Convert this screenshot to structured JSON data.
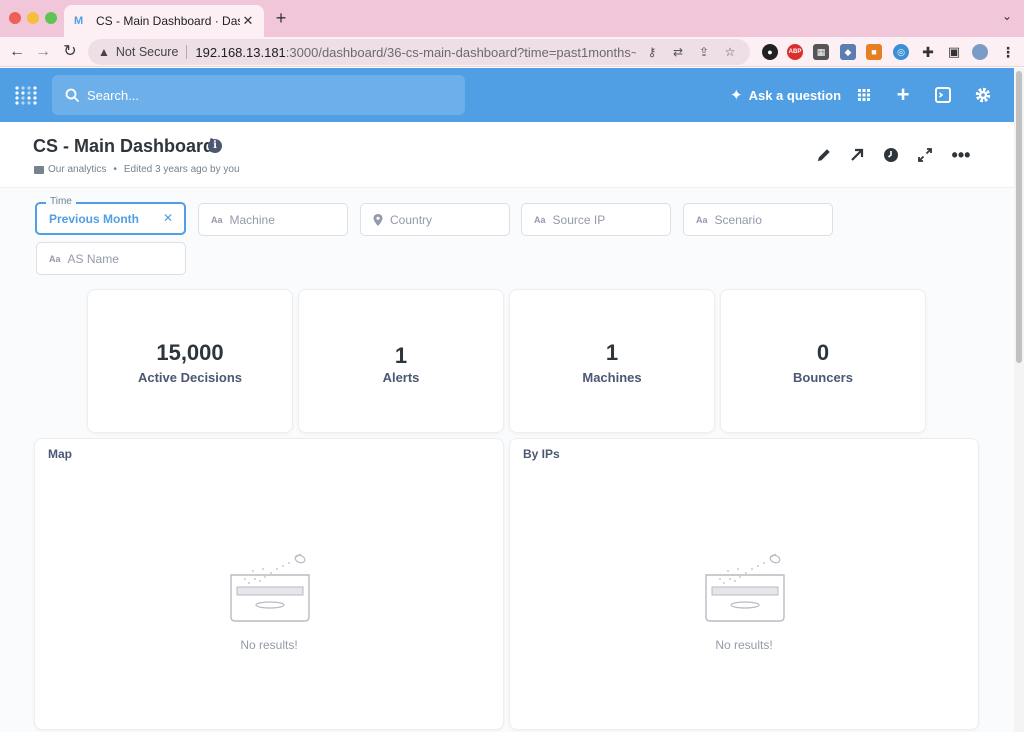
{
  "browser": {
    "tab_title": "CS - Main Dashboard · Dashboard",
    "security_label": "Not Secure",
    "url_host": "192.168.13.181",
    "url_rest": ":3000/dashboard/36-cs-main-dashboard?time=past1months~"
  },
  "header": {
    "search_placeholder": "Search...",
    "ask_label": "Ask a question"
  },
  "dashboard": {
    "title": "CS - Main Dashboard",
    "collection": "Our analytics",
    "edited": "Edited 3 years ago by you"
  },
  "filters": [
    {
      "legend": "Time",
      "value": "Previous Month",
      "active": true
    },
    {
      "label": "Machine",
      "icon": "text-icon"
    },
    {
      "label": "Country",
      "icon": "location-pin-icon"
    },
    {
      "label": "Source IP",
      "icon": "text-icon"
    },
    {
      "label": "Scenario",
      "icon": "text-icon"
    },
    {
      "label": "AS Name",
      "icon": "text-icon"
    }
  ],
  "filter_icon_glyph": "Aa",
  "scalars": [
    {
      "value": "15,000",
      "label": "Active Decisions"
    },
    {
      "value": "1",
      "label": "Alerts"
    },
    {
      "value": "1",
      "label": "Machines"
    },
    {
      "value": "0",
      "label": "Bouncers"
    }
  ],
  "panels": [
    {
      "title": "Map",
      "empty": "No results!"
    },
    {
      "title": "By IPs",
      "empty": "No results!"
    }
  ],
  "colors": {
    "brand": "#509ee3",
    "header_bg": "#509ee3",
    "tab_strip": "#f2c6d9"
  }
}
